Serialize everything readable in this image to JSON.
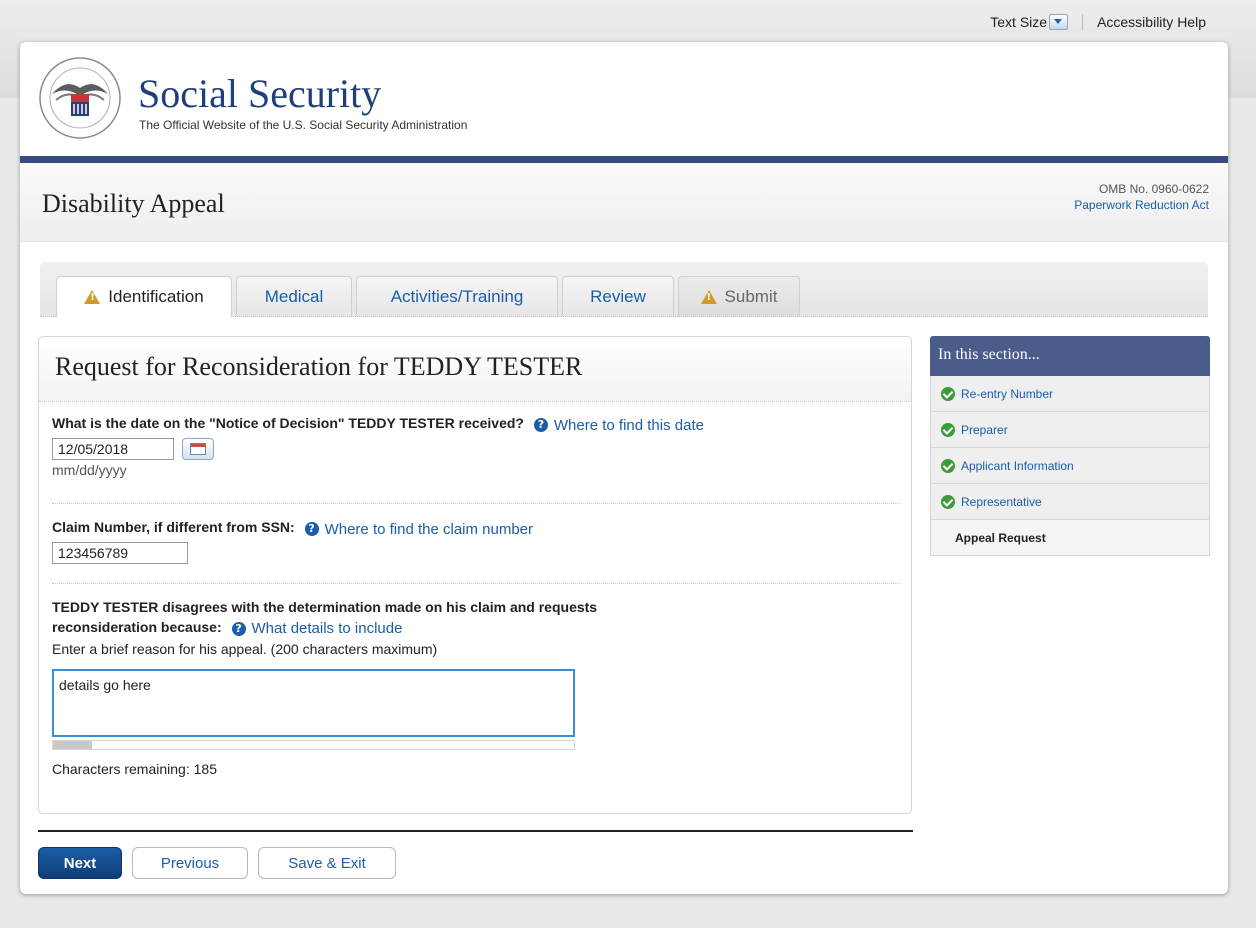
{
  "utility": {
    "text_size_label": "Text Size",
    "accessibility_help": "Accessibility Help"
  },
  "brand": {
    "title": "Social Security",
    "subtitle": "The Official Website of the U.S. Social Security Administration",
    "seal_text": "SOCIAL SECURITY ADMINISTRATION USA"
  },
  "page": {
    "title": "Disability Appeal",
    "omb": "OMB No. 0960-0622",
    "paperwork_link": "Paperwork Reduction Act"
  },
  "tabs": [
    {
      "label": "Identification",
      "state": "active",
      "warning": true
    },
    {
      "label": "Medical",
      "state": "normal",
      "warning": false
    },
    {
      "label": "Activities/Training",
      "state": "normal",
      "warning": false
    },
    {
      "label": "Review",
      "state": "normal",
      "warning": false
    },
    {
      "label": "Submit",
      "state": "disabled",
      "warning": true
    }
  ],
  "form": {
    "heading": "Request for Reconsideration for TEDDY TESTER",
    "notice_date": {
      "label": "What is the date on the \"Notice of Decision\" TEDDY TESTER received?",
      "help": "Where to find this date",
      "value": "12/05/2018",
      "format_hint": "mm/dd/yyyy"
    },
    "claim": {
      "label": "Claim Number, if different from SSN:",
      "help": "Where to find the claim number",
      "value": "123456789"
    },
    "reason": {
      "label_line1": "TEDDY TESTER disagrees with the determination made on his claim and requests",
      "label_line2": "reconsideration because:",
      "help": "What details to include",
      "instruction": "Enter a brief reason for his appeal. (200 characters maximum)",
      "value": "details go here",
      "usage_fraction": 0.075,
      "remaining_label": "Characters remaining:",
      "remaining_count": "185"
    }
  },
  "buttons": {
    "next": "Next",
    "previous": "Previous",
    "save_exit": "Save & Exit"
  },
  "sidebar": {
    "heading": "In this section...",
    "items": [
      {
        "label": "Re-entry Number",
        "complete": true
      },
      {
        "label": "Preparer",
        "complete": true
      },
      {
        "label": "Applicant Information",
        "complete": true
      },
      {
        "label": "Representative",
        "complete": true
      },
      {
        "label": "Appeal Request",
        "complete": false
      }
    ]
  },
  "colors": {
    "link": "#1a5dab",
    "navy": "#3a4c7d",
    "primary_button": "#0f3d78",
    "warning": "#d39a2a",
    "check": "#3f9a3a"
  }
}
